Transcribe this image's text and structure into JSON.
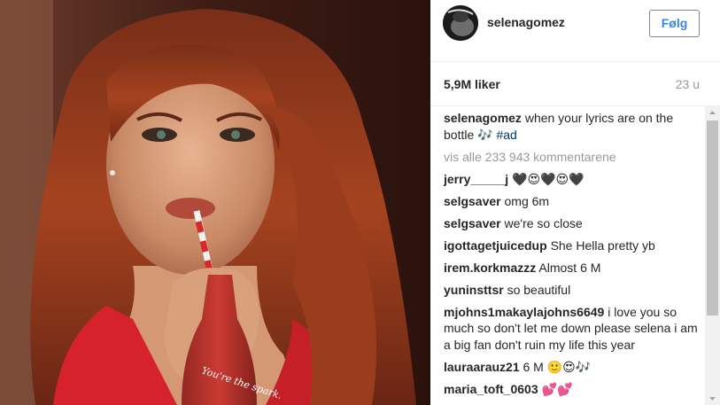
{
  "post": {
    "image_alt": "Woman with long auburn hair drinking from a Coca-Cola bottle with a straw",
    "bottle_text": "You're the spark."
  },
  "header": {
    "username": "selenagomez",
    "follow_label": "Følg"
  },
  "meta": {
    "likes": "5,9M liker",
    "time": "23 u"
  },
  "caption": {
    "user": "selenagomez",
    "text": "when your lyrics are on the bottle 🎶 ",
    "hashtag": "#ad"
  },
  "view_all": "vis alle 233 943 kommentarene",
  "comments": [
    {
      "user": "jerry_____j",
      "text": "🖤😍🖤😍🖤"
    },
    {
      "user": "selgsaver",
      "text": "omg 6m"
    },
    {
      "user": "selgsaver",
      "text": "we're so close"
    },
    {
      "user": "igottagetjuicedup",
      "text": "She Hella pretty yb"
    },
    {
      "user": "irem.korkmazzz",
      "text": "Almost 6 M"
    },
    {
      "user": "yuninsttsr",
      "text": "so beautiful"
    },
    {
      "user": "mjohns1makaylajohns6649",
      "text": "i love you so much so don't let me down please selena i am a big fan don't ruin my life this year"
    },
    {
      "user": "lauraarauz21",
      "text": "6 M 🙂😍🎶"
    },
    {
      "user": "maria_toft_0603",
      "text": "💕💕"
    }
  ],
  "colors": {
    "follow_blue": "#3d85d7",
    "muted": "#999999",
    "text": "#262626"
  }
}
